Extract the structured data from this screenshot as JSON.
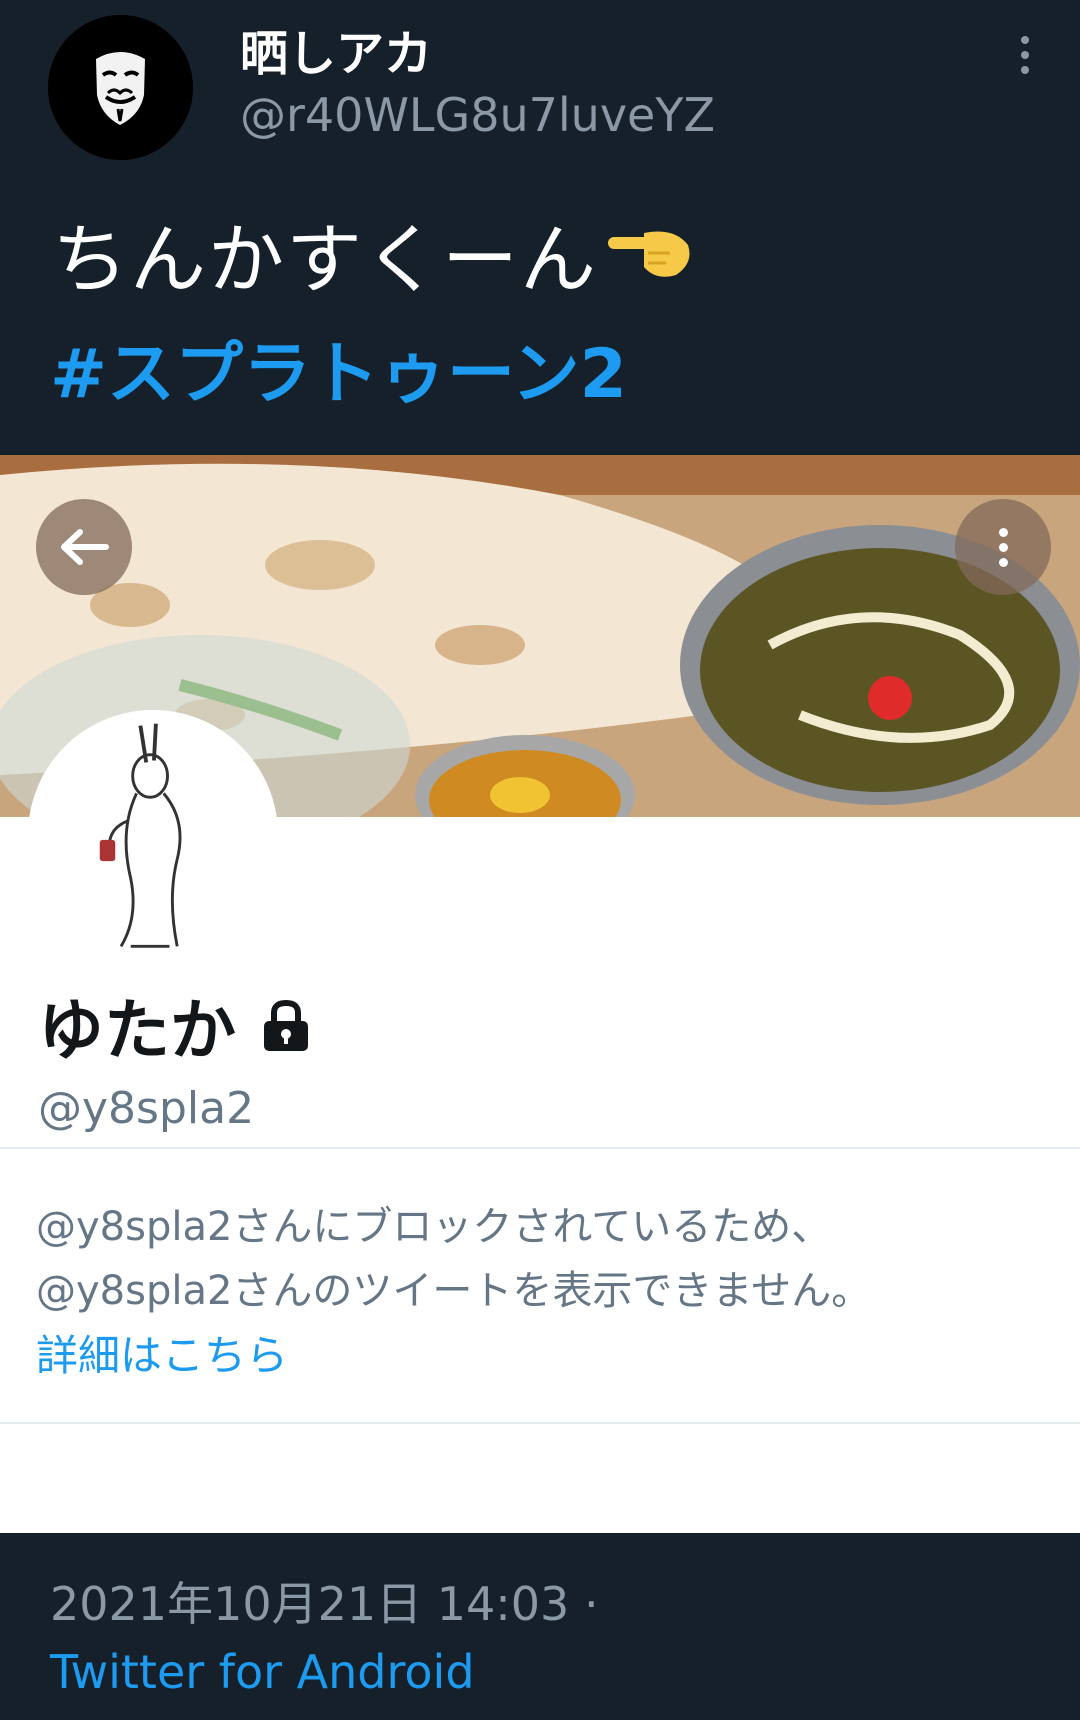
{
  "tweet": {
    "display_name": "晒しアカ",
    "handle": "@r40WLG8u7luveYZ",
    "text": "ちんかすくーん",
    "emoji_icon": "backhand-pointing-left-icon",
    "hashtag": "#スプラトゥーン2",
    "timestamp": "2021年10月21日 14:03 ·",
    "source": "Twitter for Android"
  },
  "embedded_profile": {
    "name": "ゆたか",
    "handle": "@y8spla2",
    "blocked_line_1": "@y8spla2さんにブロックされているため、",
    "blocked_line_2": "@y8spla2さんのツイートを表示できません。",
    "learn_more": "詳細はこちら"
  },
  "colors": {
    "background": "#15202b",
    "link": "#1d9bf0",
    "secondary_text": "#8b98a5"
  }
}
